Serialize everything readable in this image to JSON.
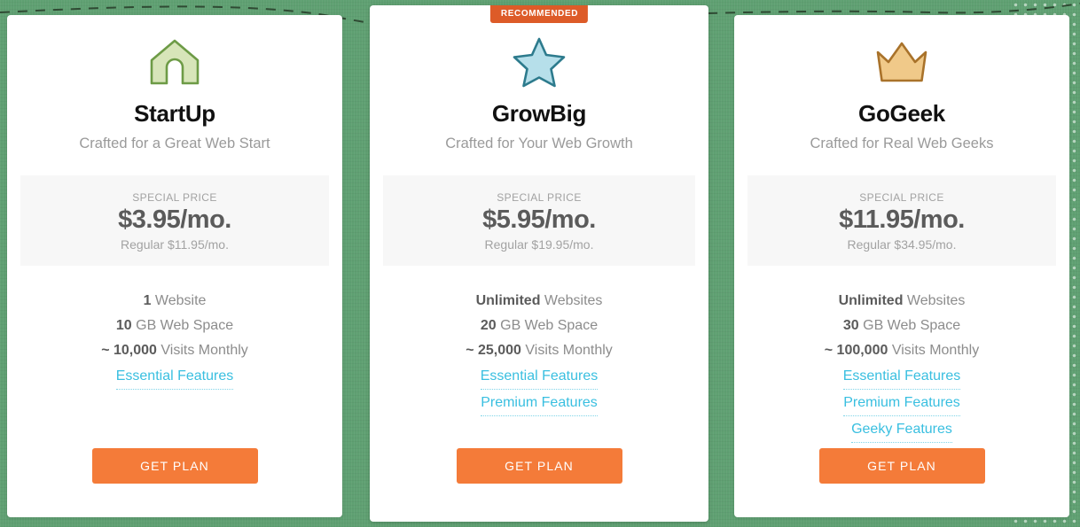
{
  "theme": {
    "background_green": "#5fa072",
    "badge_orange": "#dd5b28",
    "cta_orange": "#f47b39",
    "link_blue": "#39bfe0",
    "price_box_gray": "#f7f7f7"
  },
  "badge": {
    "label": "RECOMMENDED"
  },
  "plans": [
    {
      "id": "startup",
      "icon": "house-icon",
      "icon_fill": "#d7e5b9",
      "icon_stroke": "#6d9b46",
      "title": "StartUp",
      "subtitle": "Crafted for a Great Web Start",
      "price": {
        "label": "SPECIAL PRICE",
        "amount": "$3.95/mo.",
        "regular": "Regular $11.95/mo."
      },
      "features": [
        {
          "value": "1",
          "text": "Website"
        },
        {
          "value": "10",
          "text": "GB Web Space"
        },
        {
          "prefix": "~",
          "value": "10,000",
          "text": "Visits Monthly"
        }
      ],
      "feature_links": [
        "Essential Features"
      ],
      "cta_label": "GET PLAN"
    },
    {
      "id": "growbig",
      "icon": "star-icon",
      "icon_fill": "#b6dfea",
      "icon_stroke": "#2d7b8d",
      "title": "GrowBig",
      "subtitle": "Crafted for Your Web Growth",
      "recommended": true,
      "price": {
        "label": "SPECIAL PRICE",
        "amount": "$5.95/mo.",
        "regular": "Regular $19.95/mo."
      },
      "features": [
        {
          "value": "Unlimited",
          "text": "Websites"
        },
        {
          "value": "20",
          "text": "GB Web Space"
        },
        {
          "prefix": "~",
          "value": "25,000",
          "text": "Visits Monthly"
        }
      ],
      "feature_links": [
        "Essential Features",
        "Premium Features"
      ],
      "cta_label": "GET PLAN"
    },
    {
      "id": "gogeek",
      "icon": "crown-icon",
      "icon_fill": "#f0c989",
      "icon_stroke": "#a9722a",
      "title": "GoGeek",
      "subtitle": "Crafted for Real Web Geeks",
      "price": {
        "label": "SPECIAL PRICE",
        "amount": "$11.95/mo.",
        "regular": "Regular $34.95/mo."
      },
      "features": [
        {
          "value": "Unlimited",
          "text": "Websites"
        },
        {
          "value": "30",
          "text": "GB Web Space"
        },
        {
          "prefix": "~",
          "value": "100,000",
          "text": "Visits Monthly"
        }
      ],
      "feature_links": [
        "Essential Features",
        "Premium Features",
        "Geeky Features"
      ],
      "cta_label": "GET PLAN"
    }
  ]
}
